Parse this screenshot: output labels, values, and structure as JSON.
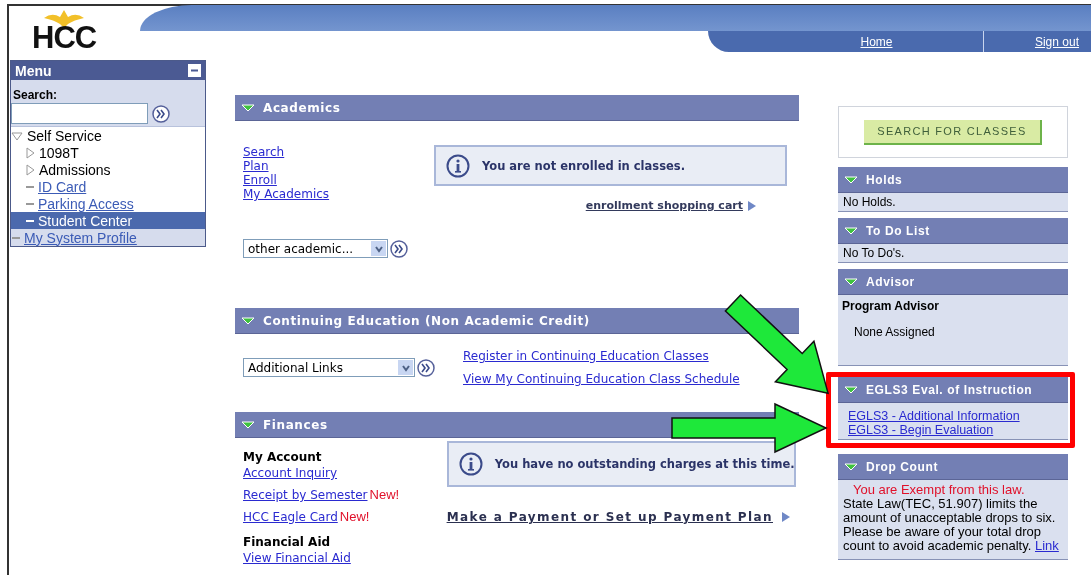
{
  "header": {
    "logo": "HCC",
    "nav": [
      "Home",
      "Sign out"
    ]
  },
  "menu": {
    "title": "Menu",
    "search_label": "Search:",
    "tree": [
      {
        "label": "Self Service",
        "kind": "folder",
        "expanded": true,
        "selected": false,
        "children": [
          {
            "label": "1098T",
            "kind": "folder",
            "expanded": false,
            "selected": false
          },
          {
            "label": "Admissions",
            "kind": "folder",
            "expanded": false,
            "selected": false
          },
          {
            "label": "ID Card",
            "kind": "link",
            "selected": false
          },
          {
            "label": "Parking Access",
            "kind": "link",
            "selected": false
          },
          {
            "label": "Student Center",
            "kind": "link",
            "selected": true
          }
        ]
      },
      {
        "label": "My System Profile",
        "kind": "link",
        "selected": false
      }
    ]
  },
  "academics": {
    "title": "Academics",
    "links": [
      "Search",
      "Plan",
      "Enroll",
      "My Academics"
    ],
    "dropdown": "other academic...",
    "message": "You are not enrolled in classes.",
    "cart_link": "enrollment shopping cart"
  },
  "continuing_education": {
    "title": "Continuing Education (Non Academic Credit)",
    "dropdown": "Additional Links",
    "links": [
      "Register in Continuing Education Classes",
      "View My Continuing Education Class Schedule"
    ]
  },
  "finances": {
    "title": "Finances",
    "sections": [
      {
        "heading": "My Account",
        "links": [
          {
            "label": "Account Inquiry"
          },
          {
            "label": "Receipt by Semester",
            "badge": "New!"
          },
          {
            "label": "HCC Eagle Card",
            "badge": "New!"
          }
        ]
      },
      {
        "heading": "Financial Aid",
        "links": [
          {
            "label": "View Financial Aid"
          }
        ]
      }
    ],
    "message": "You have no outstanding charges at this time.",
    "payment_link": "Make a Payment or Set up Payment Plan"
  },
  "sidebar": {
    "search_button": "SEARCH FOR CLASSES",
    "panels": [
      {
        "kind": "text",
        "title": "Holds",
        "text": "No Holds.",
        "highlighted": false
      },
      {
        "kind": "text",
        "title": "To Do List",
        "text": "No To Do's.",
        "highlighted": false
      },
      {
        "kind": "advisor",
        "title": "Advisor",
        "heading": "Program Advisor",
        "text": "None Assigned",
        "highlighted": false
      },
      {
        "kind": "links",
        "title": "EGLS3 Eval. of Instruction",
        "links": [
          "EGLS3 - Additional Information",
          "EGLS3 - Begin Evaluation"
        ],
        "highlighted": true
      },
      {
        "kind": "notice",
        "title": "Drop Count",
        "alert": "You are Exempt from this law.",
        "text": "State Law(TEC, 51.907) limits the amount of unacceptable drops to six. Please be aware of your total drop count to avoid academic penalty.",
        "link": "Link",
        "highlighted": false
      }
    ]
  }
}
